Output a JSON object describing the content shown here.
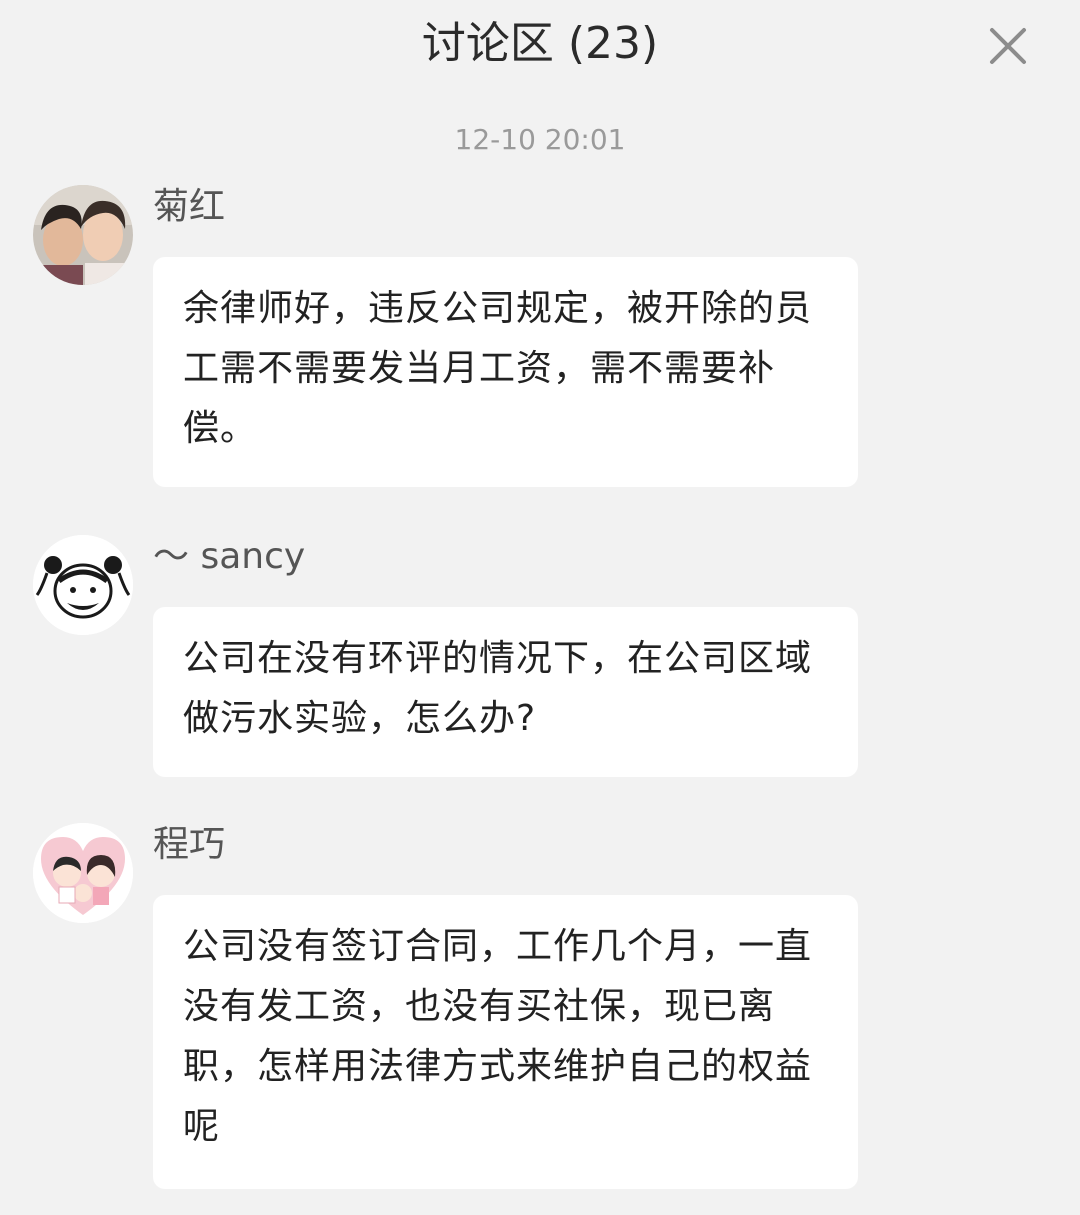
{
  "header": {
    "title": "讨论区 (23)",
    "close_icon": "close-icon"
  },
  "timestamp": "12-10 20:01",
  "messages": [
    {
      "user": "菊红",
      "avatar": "photo-avatar",
      "text": "余律师好，违反公司规定，被开除的员工需不需要发当月工资，需不需要补偿。"
    },
    {
      "user": "～ sancy",
      "avatar": "cartoon-face-avatar",
      "text": "公司在没有环评的情况下，在公司区域做污水实验，怎么办?"
    },
    {
      "user": "程巧",
      "avatar": "couple-heart-avatar",
      "text": "公司没有签订合同，工作几个月，一直没有发工资，也没有买社保，现已离职，怎样用法律方式来维护自己的权益呢"
    }
  ],
  "colors": {
    "background": "#f2f2f2",
    "bubble": "#ffffff",
    "text": "#222222",
    "muted": "#9a9a9a"
  }
}
